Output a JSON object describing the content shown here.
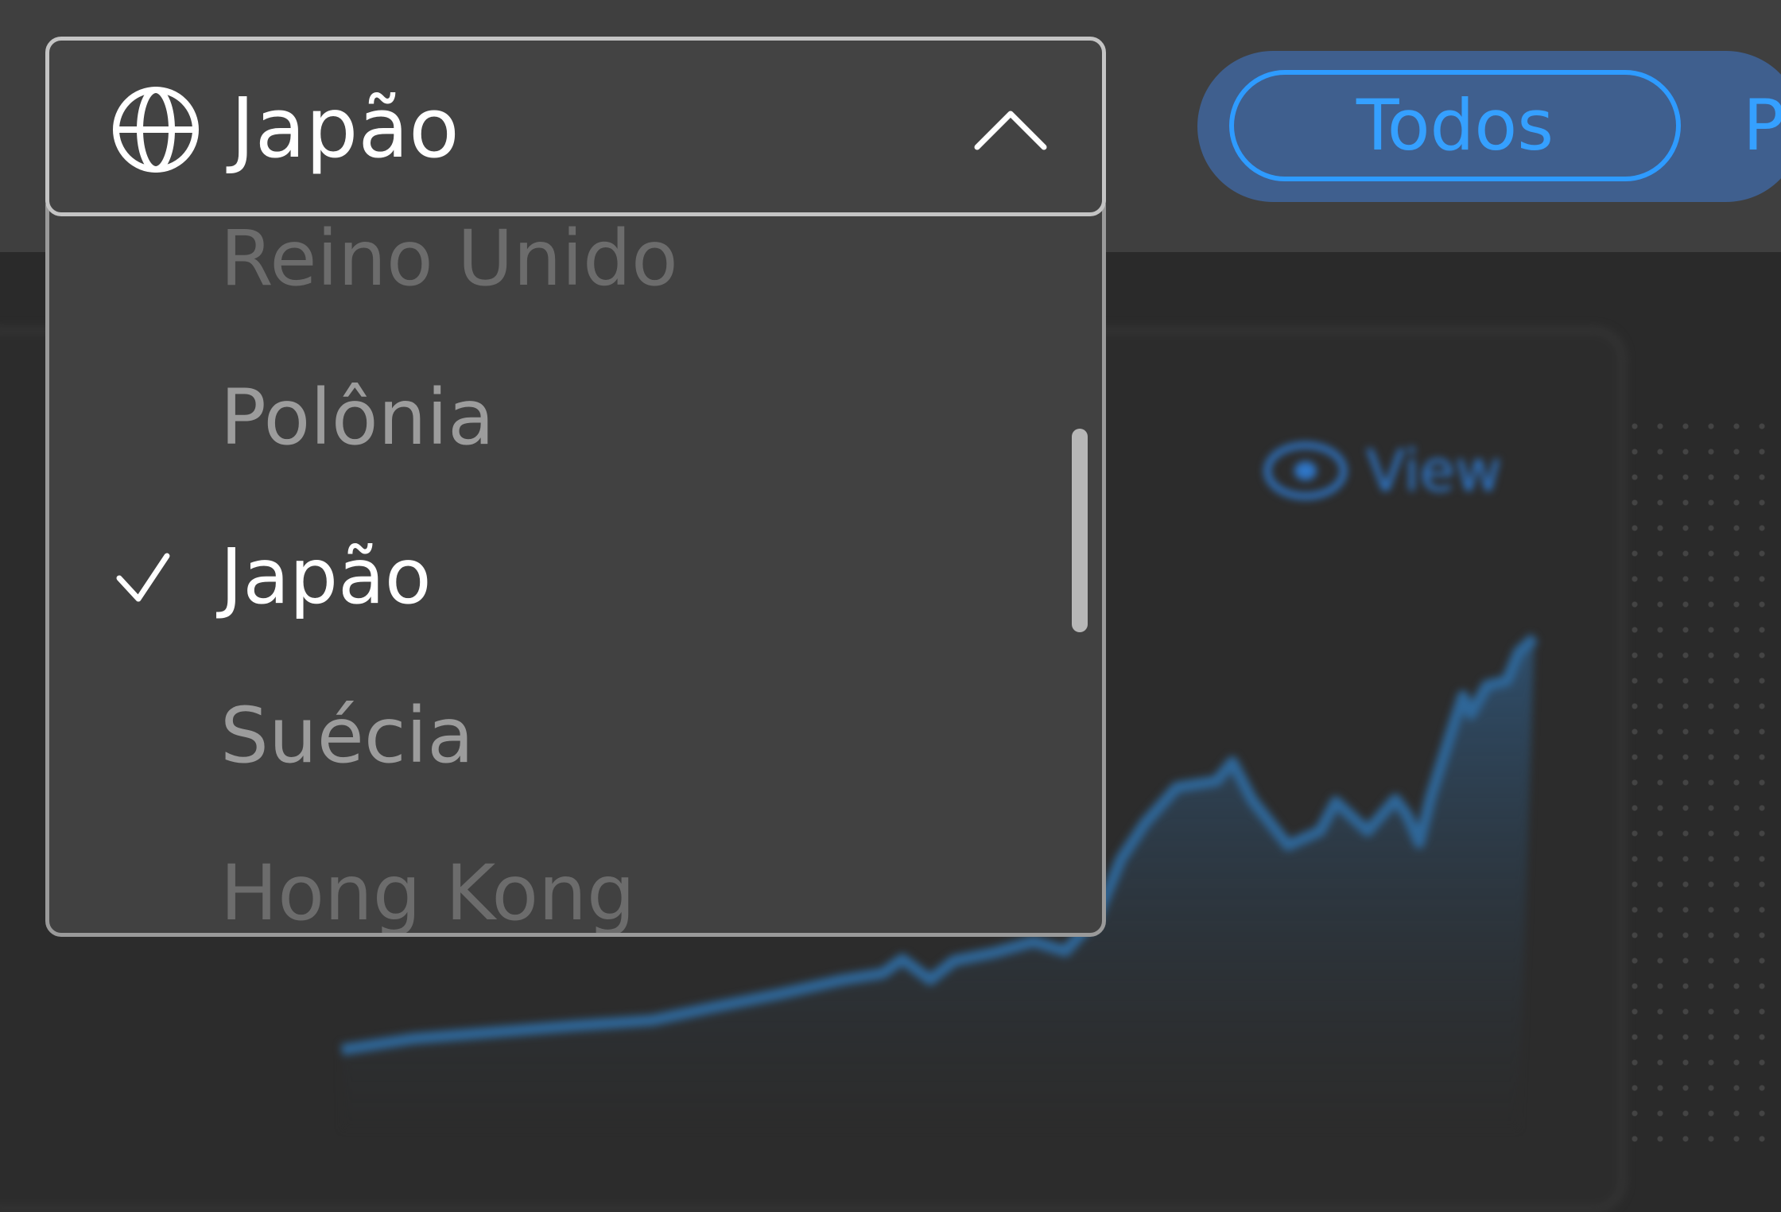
{
  "dropdown": {
    "selected_label": "Japão",
    "icon": "globe-icon",
    "expanded_icon": "chevron-up-icon",
    "options": [
      {
        "label": "Reino Unido",
        "state": "faded"
      },
      {
        "label": "Polônia",
        "state": "normal"
      },
      {
        "label": "Japão",
        "state": "selected"
      },
      {
        "label": "Suécia",
        "state": "normal"
      },
      {
        "label": "Hong Kong",
        "state": "faded"
      }
    ]
  },
  "filter_tabs": {
    "active_label": "Todos",
    "next_label_partial": "P"
  },
  "background_card": {
    "view_label": "View"
  },
  "colors": {
    "accent_blue": "#2e9bff",
    "panel_bg": "#414141",
    "topbar_bg": "#3f3f3f"
  }
}
